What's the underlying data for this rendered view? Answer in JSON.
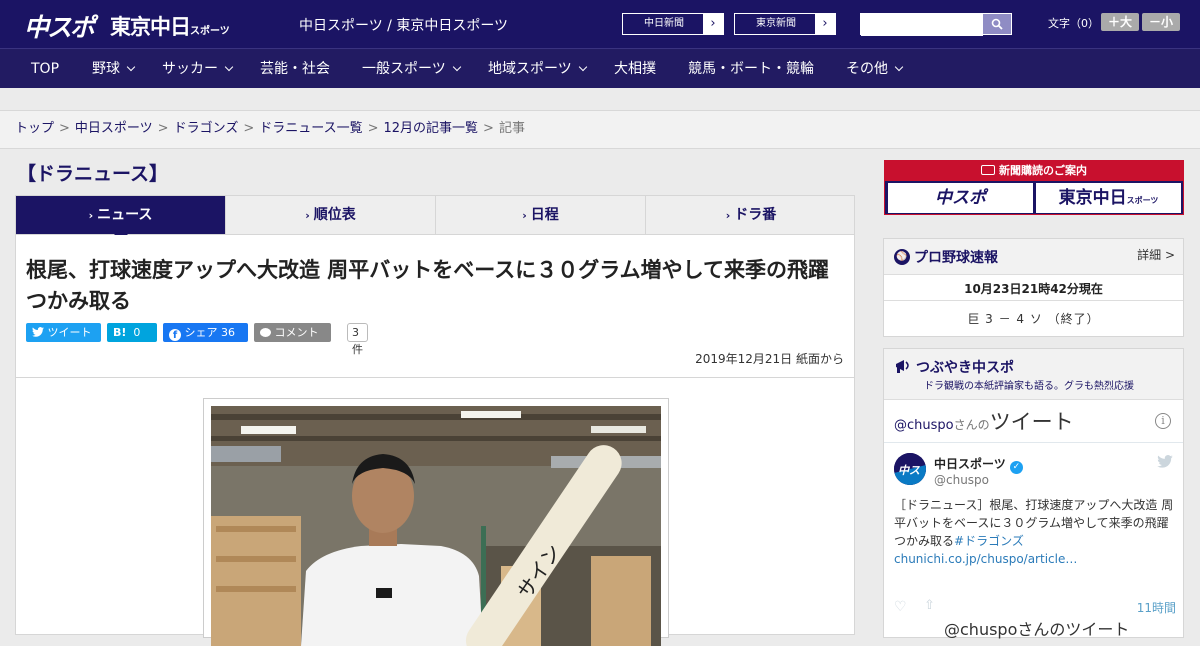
{
  "header": {
    "logo_chuspo": "中スポ",
    "logo_tokyo": "東京中日",
    "logo_tokyo_small": "スポーツ",
    "site_name": "中日スポーツ / 東京中日スポーツ",
    "paper_links": [
      "中日新聞",
      "東京新聞"
    ],
    "search_placeholder": "",
    "font_size_label": "文字（0）",
    "font_bigger": "＋大",
    "font_smaller": "－小"
  },
  "nav": {
    "items": [
      {
        "label": "TOP",
        "dropdown": false
      },
      {
        "label": "野球",
        "dropdown": true
      },
      {
        "label": "サッカー",
        "dropdown": true
      },
      {
        "label": "芸能・社会",
        "dropdown": false
      },
      {
        "label": "一般スポーツ",
        "dropdown": true
      },
      {
        "label": "地域スポーツ",
        "dropdown": true
      },
      {
        "label": "大相撲",
        "dropdown": false
      },
      {
        "label": "競馬・ボート・競輪",
        "dropdown": false
      },
      {
        "label": "その他",
        "dropdown": true
      }
    ]
  },
  "breadcrumb": {
    "links": [
      "トップ",
      "中日スポーツ",
      "ドラゴンズ",
      "ドラニュース一覧",
      "12月の記事一覧"
    ],
    "current": "記事",
    "separator": ">"
  },
  "main": {
    "section_title": "【ドラニュース】",
    "tabs": [
      "ニュース",
      "順位表",
      "日程",
      "ドラ番"
    ],
    "active_tab": 0,
    "headline": "根尾、打球速度アップへ大改造 周平バットをベースに３０グラム増やして来季の飛躍つかみ取る",
    "social": {
      "tweet": "ツイート",
      "hatena_count": "0",
      "share": "シェア",
      "share_count": "36",
      "comment": "コメント",
      "comment_count": "3件"
    },
    "date": "2019年12月21日 紙面から"
  },
  "sidebar": {
    "ad_title": "新聞購読のご案内",
    "ad_logos": [
      "中スポ",
      "東京中日"
    ],
    "ad_logo_small": "スポーツ",
    "baseball": {
      "title": "プロ野球速報",
      "detail_link": "詳細 >",
      "time": "10月23日21時42分現在",
      "score": "巨 3 － 4 ソ （終了）"
    },
    "tweets": {
      "title": "つぶやき中スポ",
      "subtitle": "ドラ観戦の本紙評論家も語る。グラも熱烈応援",
      "header_handle": "@chuspo",
      "header_san": "さんの",
      "header_tweet": "ツイート",
      "account_name": "中日スポーツ",
      "account_handle": "@chuspo",
      "text_prefix": "［ドラニュース］根尾、打球速度アップへ大改造 周平バットをベースに３０グラム増やして来季の飛躍つかみ取る",
      "hashtag": "#ドラゴンズ",
      "link": "chunichi.co.jp/chuspo/article…",
      "time": "11時間",
      "more": "@chuspoさんのツイート"
    }
  },
  "colors": {
    "brand_navy": "#1b1464",
    "ad_red": "#c8102e",
    "twitter_blue": "#1da1f2",
    "hatena_blue": "#00a4de",
    "facebook_blue": "#3b5998",
    "comment_gray": "#888888"
  }
}
